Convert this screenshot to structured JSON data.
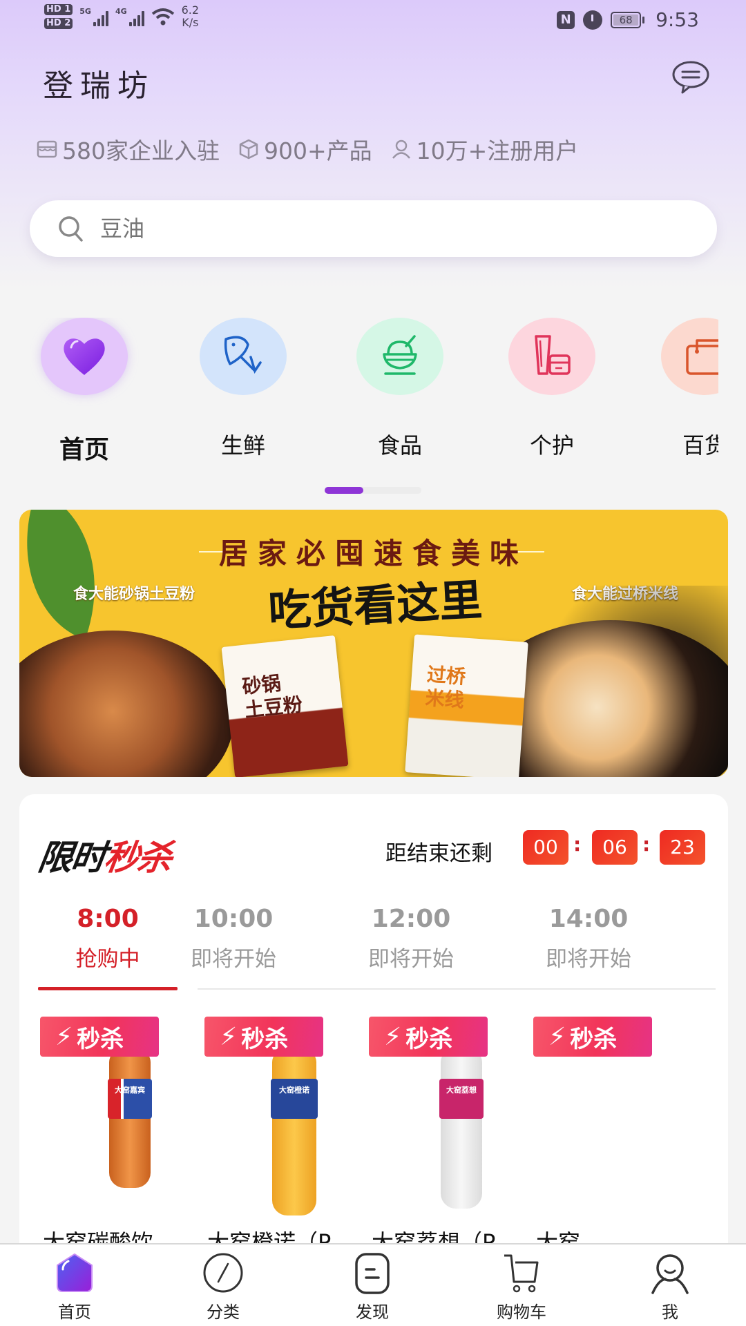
{
  "status_bar": {
    "hd1": "HD 1",
    "hd2": "HD 2",
    "net1": "5G",
    "net2": "4G",
    "speed_value": "6.2",
    "speed_unit": "K/s",
    "nfc": "N",
    "battery": "68",
    "time": "9:53"
  },
  "header": {
    "app_title": "登瑞坊",
    "message_icon": "chat-bubble-icon"
  },
  "stats": [
    {
      "icon": "store-icon",
      "text": "580家企业入驻"
    },
    {
      "icon": "box-icon",
      "text": "900+产品"
    },
    {
      "icon": "user-icon",
      "text": "10万+注册用户"
    }
  ],
  "search": {
    "placeholder": "豆油",
    "value": ""
  },
  "categories": [
    {
      "label": "首页",
      "icon": "heart-icon",
      "active": true,
      "bg": "#e4c6fb",
      "color": "#8a2be2"
    },
    {
      "label": "生鲜",
      "icon": "fish-icon",
      "active": false,
      "bg": "#d3e4fb",
      "color": "#1f63c8"
    },
    {
      "label": "食品",
      "icon": "bowl-icon",
      "active": false,
      "bg": "#d5f7e6",
      "color": "#1fb86a"
    },
    {
      "label": "个护",
      "icon": "cosmetics-icon",
      "active": false,
      "bg": "#fdd6de",
      "color": "#e0345a"
    },
    {
      "label": "百货",
      "icon": "bag-icon",
      "active": false,
      "bg": "#fcd9cf",
      "color": "#d9552c"
    }
  ],
  "category_pager": {
    "current": 1,
    "total": 2
  },
  "banner": {
    "title": "居家必囤速食美味",
    "left_product": "食大能砂锅土豆粉",
    "right_product": "食大能过桥米线",
    "slogan": "吃货看这里",
    "pack1_text": "砂锅\n土豆粉",
    "pack2_text": "过桥\n米线"
  },
  "flash_sale": {
    "logo_black": "限时",
    "logo_red": "秒杀",
    "countdown_label": "距结束还剩",
    "countdown": {
      "hours": "00",
      "minutes": "06",
      "seconds": "23"
    },
    "time_slots": [
      {
        "time": "8:00",
        "status": "抢购中",
        "active": true
      },
      {
        "time": "10:00",
        "status": "即将开始",
        "active": false
      },
      {
        "time": "12:00",
        "status": "即将开始",
        "active": false
      },
      {
        "time": "14:00",
        "status": "即将开始",
        "active": false
      }
    ],
    "badge_label": "秒杀",
    "products": [
      {
        "name": "大窑碳酸饮...",
        "bottle_color": "#e07a2c",
        "label_color": "#2c4fa8",
        "label_text": "大窑嘉宾"
      },
      {
        "name": "大窑橙诺（P...",
        "bottle_color": "#f7b52a",
        "label_color": "#27479a",
        "label_text": "大窑橙诺"
      },
      {
        "name": "大窑荔想（P...",
        "bottle_color": "#eeeeee",
        "label_color": "#c8256a",
        "label_text": "大窑荔想"
      },
      {
        "name": "大窑",
        "bottle_color": "#f0f0f0",
        "label_color": "#c8256a",
        "label_text": ""
      }
    ]
  },
  "bottom_nav": [
    {
      "label": "首页",
      "icon": "home-icon",
      "active": true
    },
    {
      "label": "分类",
      "icon": "compass-icon",
      "active": false
    },
    {
      "label": "发现",
      "icon": "discover-icon",
      "active": false
    },
    {
      "label": "购物车",
      "icon": "cart-icon",
      "active": false
    },
    {
      "label": "我",
      "icon": "profile-icon",
      "active": false
    }
  ],
  "colors": {
    "accent_purple": "#8e35d6",
    "flash_red": "#d42028",
    "countdown_red": "#ee2a22"
  }
}
